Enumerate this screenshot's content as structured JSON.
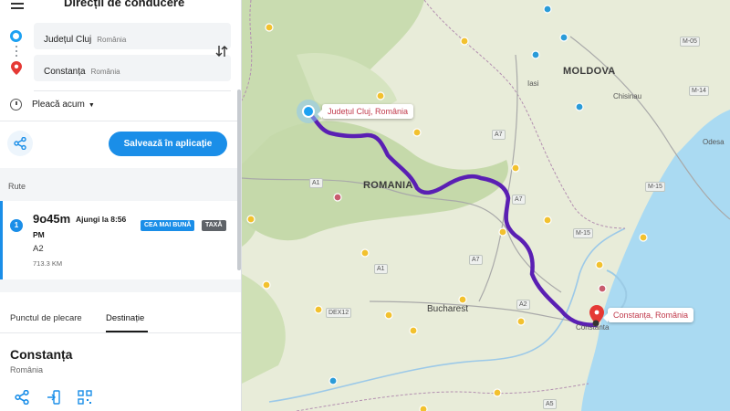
{
  "sidebar": {
    "title": "Direcții de conducere",
    "origin": {
      "name": "Județul Cluj",
      "country": "România"
    },
    "destination": {
      "name": "Constanța",
      "country": "România"
    },
    "depart_label": "Pleacă acum",
    "save_button": "Salvează în aplicație",
    "routes_label": "Rute",
    "route": {
      "index": "1",
      "duration": "9o45m",
      "arrive_prefix": "Ajungi la 8:56",
      "arrive_suffix": "PM",
      "badge_best": "CEA MAI BUNĂ",
      "badge_toll": "TAXĂ",
      "road": "A2",
      "distance": "713.3 KM"
    },
    "tabs": {
      "start": "Punctul de plecare",
      "destination": "Destinație"
    },
    "place": {
      "name": "Constanța",
      "country": "România"
    }
  },
  "map": {
    "labels": {
      "moldova": "MOLDOVA",
      "romania": "ROMANIA",
      "bucharest": "Bucharest",
      "chisinau": "Chisinau",
      "iasi": "Iasi",
      "odesa": "Odesa",
      "constanta_city": "Constanta"
    },
    "roads": {
      "a1_1": "A1",
      "a1_2": "A1",
      "a7_1": "A7",
      "a7_2": "A7",
      "a7_3": "A7",
      "a2": "A2",
      "a5": "A5",
      "m05": "M-05",
      "m14": "M-14",
      "m15": "M-15",
      "e15": "M-15",
      "dex12": "DEX12"
    },
    "callout_origin": "Județul Cluj, România",
    "callout_dest": "Constanța, România",
    "colors": {
      "route": "#5a1fb3",
      "water": "#aadaf2",
      "land": "#e8ecd9",
      "forest": "#c9dcb0",
      "accent": "#1a8ee8"
    }
  }
}
